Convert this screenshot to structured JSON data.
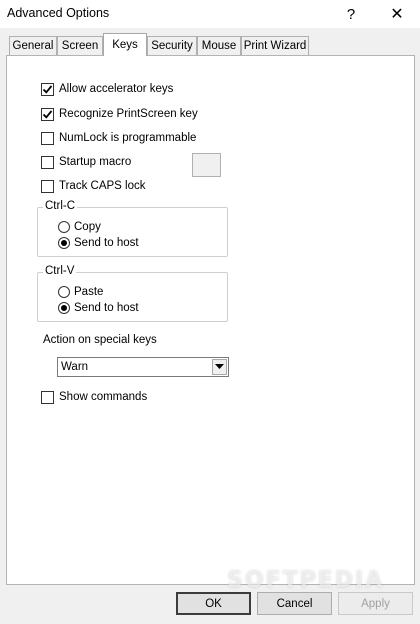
{
  "window": {
    "title": "Advanced Options",
    "help_label": "?",
    "close_label": "✕"
  },
  "tabs": [
    {
      "label": "General"
    },
    {
      "label": "Screen"
    },
    {
      "label": "Keys"
    },
    {
      "label": "Security"
    },
    {
      "label": "Mouse"
    },
    {
      "label": "Print Wizard"
    }
  ],
  "active_tab": "Keys",
  "options": {
    "allow_accelerator": {
      "label": "Allow accelerator keys",
      "checked": true
    },
    "recognize_printscreen": {
      "label": "Recognize PrintScreen key",
      "checked": true
    },
    "numlock_programmable": {
      "label": "NumLock is programmable",
      "checked": false
    },
    "startup_macro": {
      "label": "Startup macro",
      "checked": false
    },
    "track_caps": {
      "label": "Track CAPS lock",
      "checked": false
    },
    "show_commands": {
      "label": "Show commands",
      "checked": false
    }
  },
  "ctrl_c": {
    "title": "Ctrl-C",
    "copy_label": "Copy",
    "send_label": "Send to host",
    "selected": "send"
  },
  "ctrl_v": {
    "title": "Ctrl-V",
    "paste_label": "Paste",
    "send_label": "Send to host",
    "selected": "send"
  },
  "special_keys": {
    "label": "Action on special keys",
    "value": "Warn"
  },
  "buttons": {
    "ok": "OK",
    "cancel": "Cancel",
    "apply": "Apply"
  },
  "watermark": "SOFTPEDIA",
  "colors": {
    "window_bg": "#f0f0f0",
    "panel_bg": "#ffffff",
    "button_bg": "#e1e1e1",
    "disabled_text": "#a0a0a0"
  }
}
